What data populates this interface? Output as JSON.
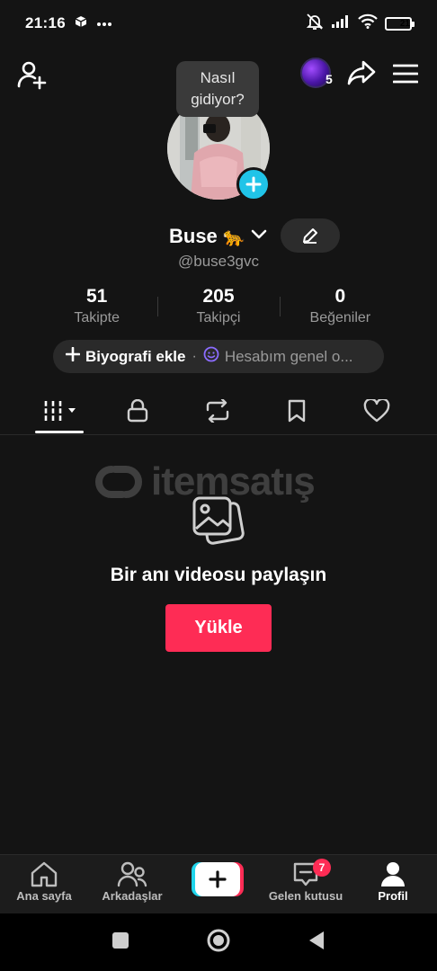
{
  "status_bar": {
    "time": "21:16",
    "battery": "21"
  },
  "top_nav": {
    "coin_count": "5",
    "tooltip": "Nasıl gidiyor?"
  },
  "profile": {
    "display_name": "Buse",
    "name_emoji": "🐆",
    "username": "@buse3gvc"
  },
  "stats": [
    {
      "value": "51",
      "label": "Takipte"
    },
    {
      "value": "205",
      "label": "Takipçi"
    },
    {
      "value": "0",
      "label": "Beğeniler"
    }
  ],
  "bio": {
    "add_label": "Biyografi ekle",
    "status_label": "Hesabım genel o..."
  },
  "tabs": [
    {
      "icon": "grid-icon",
      "active": true
    },
    {
      "icon": "lock-icon",
      "active": false
    },
    {
      "icon": "repost-icon",
      "active": false
    },
    {
      "icon": "bookmark-icon",
      "active": false
    },
    {
      "icon": "heart-icon",
      "active": false
    }
  ],
  "empty_state": {
    "watermark": "itemsatış",
    "title": "Bir anı videosu paylaşın",
    "upload_label": "Yükle"
  },
  "bottom_nav": {
    "items": [
      {
        "label": "Ana sayfa",
        "icon": "home-icon"
      },
      {
        "label": "Arkadaşlar",
        "icon": "friends-icon"
      },
      {
        "label": "",
        "icon": "create-icon"
      },
      {
        "label": "Gelen kutusu",
        "icon": "inbox-icon"
      },
      {
        "label": "Profil",
        "icon": "profile-icon"
      }
    ],
    "inbox_badge": "7"
  },
  "colors": {
    "accent": "#fe2c55",
    "cyan": "#20c4e8",
    "background": "#141414"
  }
}
